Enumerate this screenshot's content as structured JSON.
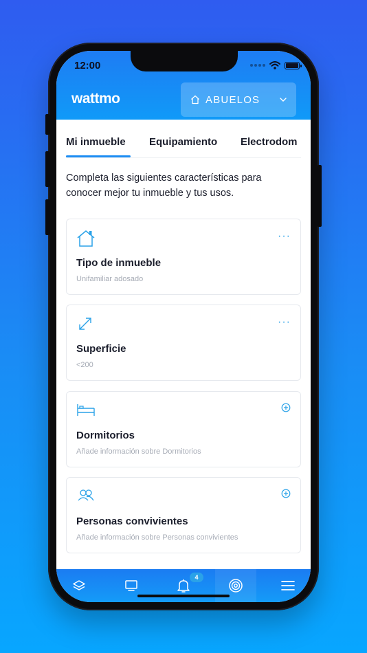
{
  "status_bar": {
    "time": "12:00"
  },
  "header": {
    "logo": "wattmo",
    "home_selector": {
      "label": "ABUELOS",
      "icon": "home-icon"
    }
  },
  "tabs": [
    {
      "label": "Mi inmueble",
      "active": true
    },
    {
      "label": "Equipamiento",
      "active": false
    },
    {
      "label": "Electrodom",
      "active": false
    }
  ],
  "intro_text": "Completa las siguientes características para conocer mejor tu inmueble y tus usos.",
  "cards": [
    {
      "icon": "house-icon",
      "title": "Tipo de inmueble",
      "subtitle": "Unifamiliar adosado",
      "action": "more-icon"
    },
    {
      "icon": "expand-icon",
      "title": "Superficie",
      "subtitle": "<200",
      "action": "more-icon"
    },
    {
      "icon": "bed-icon",
      "title": "Dormitorios",
      "subtitle": "Añade información sobre Dormitorios",
      "action": "add-icon"
    },
    {
      "icon": "people-icon",
      "title": "Personas convivientes",
      "subtitle": "Añade información sobre Personas convivientes",
      "action": "add-icon"
    }
  ],
  "bottom_nav": {
    "items": [
      {
        "icon": "layers-icon"
      },
      {
        "icon": "tv-icon"
      },
      {
        "icon": "bell-icon",
        "badge": "4"
      },
      {
        "icon": "target-icon",
        "active": true
      },
      {
        "icon": "menu-icon"
      }
    ]
  },
  "colors": {
    "accent": "#1d8df3",
    "icon": "#2aa2e8",
    "text": "#1b1e2c",
    "muted": "#a7acb6"
  }
}
